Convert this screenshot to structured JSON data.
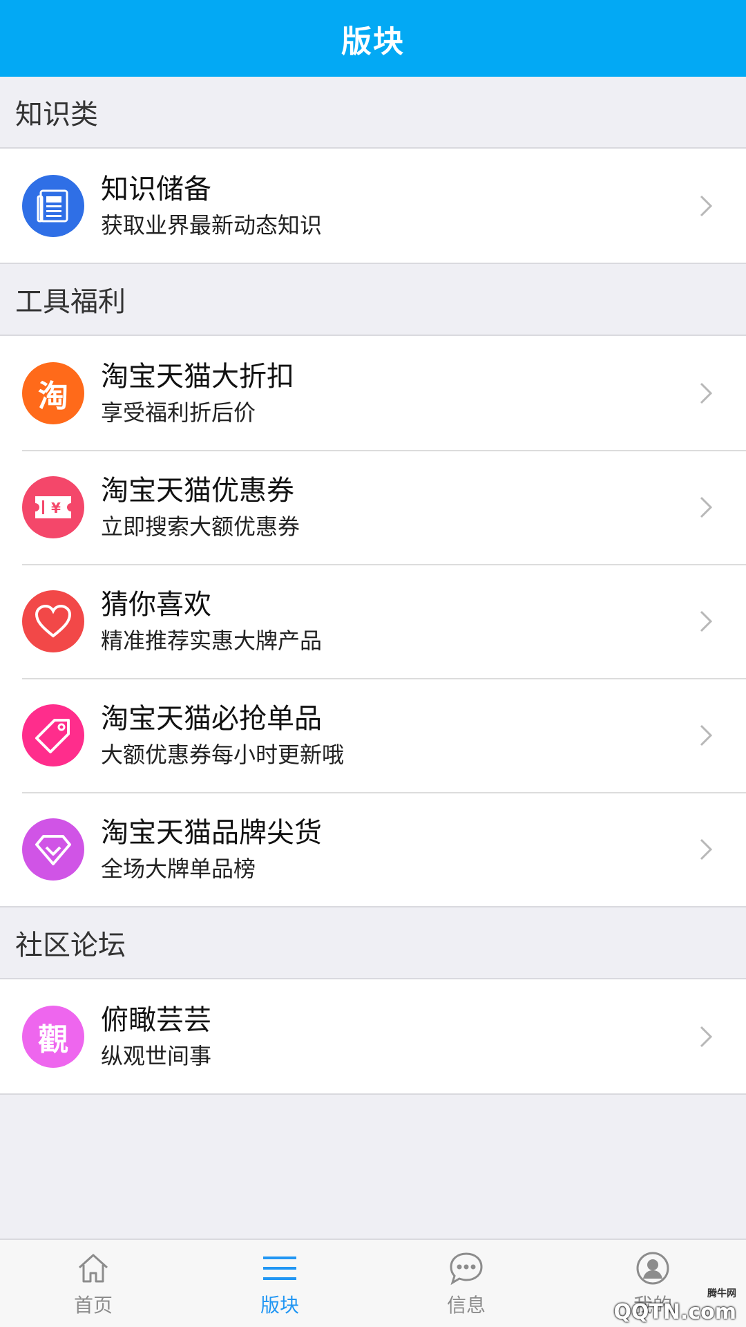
{
  "header": {
    "title": "版块"
  },
  "sections": [
    {
      "title": "知识类",
      "items": [
        {
          "title": "知识储备",
          "subtitle": "获取业界最新动态知识",
          "icon": "newspaper-icon",
          "color": "#2f6fe6"
        }
      ]
    },
    {
      "title": "工具福利",
      "items": [
        {
          "title": "淘宝天猫大折扣",
          "subtitle": "享受福利折后价",
          "icon": "tao-icon",
          "icon_text": "淘",
          "color": "#ff6a1a"
        },
        {
          "title": "淘宝天猫优惠券",
          "subtitle": "立即搜索大额优惠券",
          "icon": "coupon-icon",
          "icon_text": "¥",
          "color": "#f4476a"
        },
        {
          "title": "猜你喜欢",
          "subtitle": "精准推荐实惠大牌产品",
          "icon": "heart-icon",
          "color": "#f24848"
        },
        {
          "title": "淘宝天猫必抢单品",
          "subtitle": "大额优惠券每小时更新哦",
          "icon": "tag-icon",
          "color": "#ff2d8c"
        },
        {
          "title": "淘宝天猫品牌尖货",
          "subtitle": "全场大牌单品榜",
          "icon": "diamond-icon",
          "color": "#d054e6"
        }
      ]
    },
    {
      "title": "社区论坛",
      "items": [
        {
          "title": "俯瞰芸芸",
          "subtitle": "纵观世间事",
          "icon": "guan-icon",
          "icon_text": "觀",
          "color": "#ee66ee"
        }
      ]
    }
  ],
  "tabbar": {
    "items": [
      {
        "label": "首页",
        "icon": "home-icon",
        "active": false
      },
      {
        "label": "版块",
        "icon": "menu-icon",
        "active": true
      },
      {
        "label": "信息",
        "icon": "chat-icon",
        "active": false
      },
      {
        "label": "我的",
        "icon": "user-icon",
        "active": false
      }
    ]
  },
  "watermark": {
    "text": "QQTN.com",
    "small": "腾牛网"
  },
  "colors": {
    "header_bg": "#03a9f4",
    "active_tab": "#2196f3",
    "inactive_tab": "#8c8c8c",
    "page_bg": "#efeff4"
  }
}
